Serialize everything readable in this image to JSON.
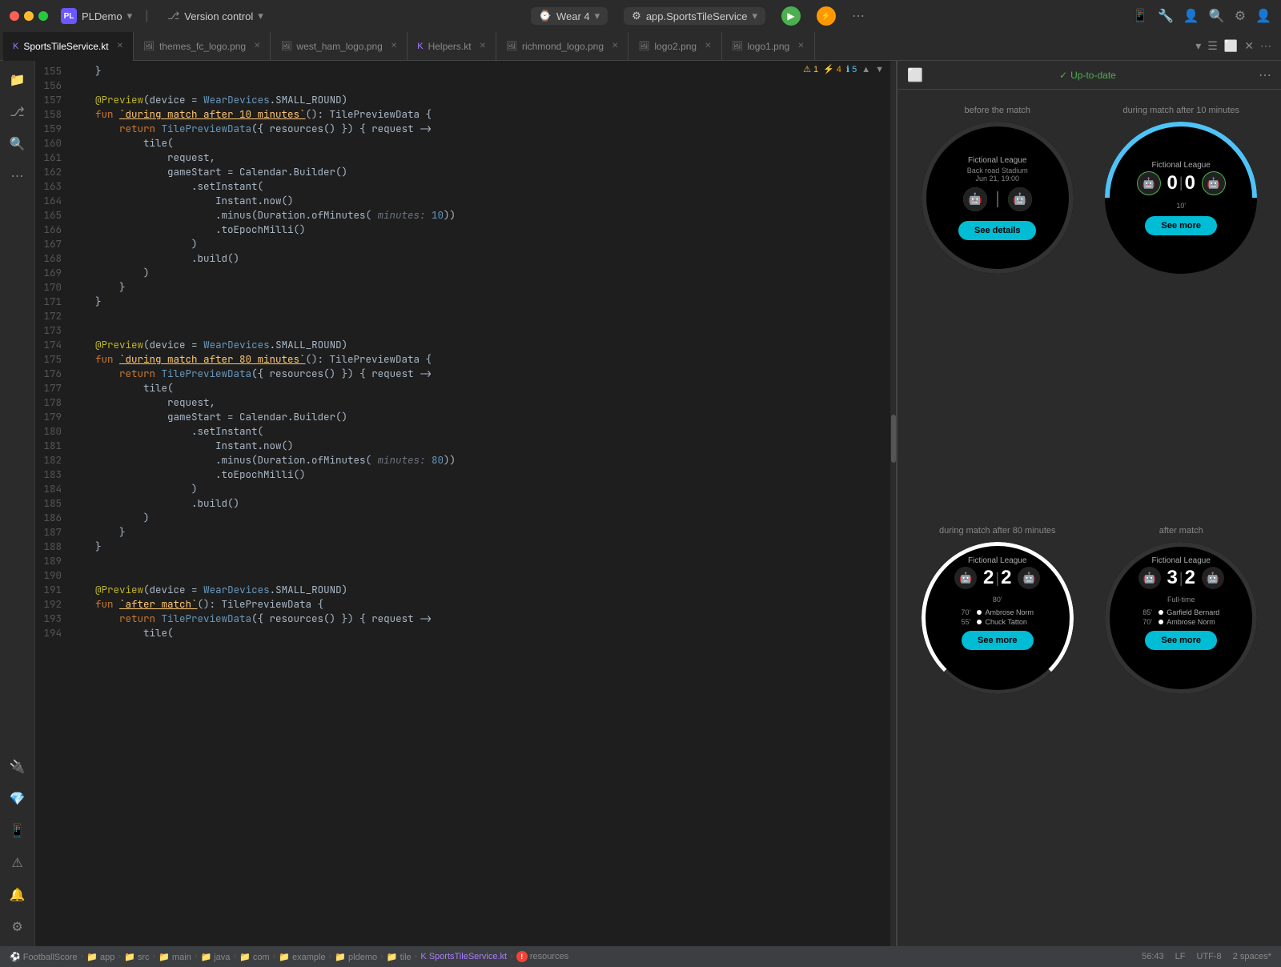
{
  "titlebar": {
    "project_icon_label": "PL",
    "project_name": "PLDemo",
    "version_control_label": "Version control",
    "device_label": "Wear 4",
    "service_label": "app.SportsTileService",
    "run_icon": "▶",
    "debug_icon": "⚡",
    "menu_icon": "⋯"
  },
  "tabs": [
    {
      "label": "SportsTileService.kt",
      "icon": "K",
      "active": true,
      "closeable": true
    },
    {
      "label": "themes_fc_logo.png",
      "icon": "🖼",
      "active": false,
      "closeable": true
    },
    {
      "label": "west_ham_logo.png",
      "icon": "🖼",
      "active": false,
      "closeable": true
    },
    {
      "label": "Helpers.kt",
      "icon": "K",
      "active": false,
      "closeable": true
    },
    {
      "label": "richmond_logo.png",
      "icon": "🖼",
      "active": false,
      "closeable": true
    },
    {
      "label": "logo2.png",
      "icon": "🖼",
      "active": false,
      "closeable": true
    },
    {
      "label": "logo1.png",
      "icon": "🖼",
      "active": false,
      "closeable": true
    }
  ],
  "editor": {
    "warnings": {
      "yellow": "1",
      "orange": "4",
      "blue": "5"
    },
    "lines": [
      {
        "num": "155",
        "tokens": [
          {
            "t": "    }",
            "c": "white"
          }
        ]
      },
      {
        "num": "156",
        "tokens": []
      },
      {
        "num": "157",
        "tokens": [
          {
            "t": "    @Preview",
            "c": "ann"
          },
          {
            "t": "(",
            "c": "white"
          },
          {
            "t": "device",
            "c": "white"
          },
          {
            "t": " = ",
            "c": "white"
          },
          {
            "t": "WearDevices",
            "c": "cls"
          },
          {
            "t": ".",
            "c": "white"
          },
          {
            "t": "SMALL_ROUND",
            "c": "white"
          },
          {
            "t": ")",
            "c": "white"
          }
        ]
      },
      {
        "num": "158",
        "tokens": [
          {
            "t": "    fun ",
            "c": "kw"
          },
          {
            "t": "`during match after 10 minutes`",
            "c": "fn",
            "underline": true
          },
          {
            "t": "(): TilePreviewData {",
            "c": "white"
          }
        ]
      },
      {
        "num": "159",
        "tokens": [
          {
            "t": "        return ",
            "c": "kw"
          },
          {
            "t": "TilePreviewData",
            "c": "cls"
          },
          {
            "t": "({ ",
            "c": "white"
          },
          {
            "t": "resources()",
            "c": "white"
          },
          {
            "t": " }) { request ->",
            "c": "white"
          }
        ]
      },
      {
        "num": "160",
        "tokens": [
          {
            "t": "            tile(",
            "c": "white"
          }
        ]
      },
      {
        "num": "161",
        "tokens": [
          {
            "t": "                request,",
            "c": "white"
          }
        ]
      },
      {
        "num": "162",
        "tokens": [
          {
            "t": "                gameStart = Calendar.Builder()",
            "c": "white"
          }
        ]
      },
      {
        "num": "163",
        "tokens": [
          {
            "t": "                    .setInstant(",
            "c": "white"
          }
        ]
      },
      {
        "num": "164",
        "tokens": [
          {
            "t": "                        Instant.now()",
            "c": "white"
          }
        ]
      },
      {
        "num": "165",
        "tokens": [
          {
            "t": "                        .minus(Duration.ofMinutes(",
            "c": "white"
          },
          {
            "t": " minutes: ",
            "c": "hint"
          },
          {
            "t": "10",
            "c": "num"
          },
          {
            "t": "))",
            "c": "white"
          }
        ]
      },
      {
        "num": "166",
        "tokens": [
          {
            "t": "                        .toEpochMilli()",
            "c": "white"
          }
        ]
      },
      {
        "num": "167",
        "tokens": [
          {
            "t": "                    )",
            "c": "white"
          }
        ]
      },
      {
        "num": "168",
        "tokens": [
          {
            "t": "                    .build()",
            "c": "white"
          }
        ]
      },
      {
        "num": "169",
        "tokens": [
          {
            "t": "            )",
            "c": "white"
          }
        ]
      },
      {
        "num": "170",
        "tokens": [
          {
            "t": "        }",
            "c": "white"
          }
        ]
      },
      {
        "num": "171",
        "tokens": [
          {
            "t": "    }",
            "c": "white"
          }
        ]
      },
      {
        "num": "172",
        "tokens": []
      },
      {
        "num": "173",
        "tokens": []
      },
      {
        "num": "174",
        "tokens": [
          {
            "t": "    @Preview",
            "c": "ann"
          },
          {
            "t": "(",
            "c": "white"
          },
          {
            "t": "device",
            "c": "white"
          },
          {
            "t": " = ",
            "c": "white"
          },
          {
            "t": "WearDevices",
            "c": "cls"
          },
          {
            "t": ".",
            "c": "white"
          },
          {
            "t": "SMALL_ROUND",
            "c": "white"
          },
          {
            "t": ")",
            "c": "white"
          }
        ]
      },
      {
        "num": "175",
        "tokens": [
          {
            "t": "    fun ",
            "c": "kw"
          },
          {
            "t": "`during match after 80 minutes`",
            "c": "fn",
            "underline": true
          },
          {
            "t": "(): TilePreviewData {",
            "c": "white"
          }
        ]
      },
      {
        "num": "176",
        "tokens": [
          {
            "t": "        return ",
            "c": "kw"
          },
          {
            "t": "TilePreviewData",
            "c": "cls"
          },
          {
            "t": "({ ",
            "c": "white"
          },
          {
            "t": "resources()",
            "c": "white"
          },
          {
            "t": " }) { request ->",
            "c": "white"
          }
        ]
      },
      {
        "num": "177",
        "tokens": [
          {
            "t": "            tile(",
            "c": "white"
          }
        ]
      },
      {
        "num": "178",
        "tokens": [
          {
            "t": "                request,",
            "c": "white"
          }
        ]
      },
      {
        "num": "179",
        "tokens": [
          {
            "t": "                gameStart = Calendar.Builder()",
            "c": "white"
          }
        ]
      },
      {
        "num": "180",
        "tokens": [
          {
            "t": "                    .setInstant(",
            "c": "white"
          }
        ]
      },
      {
        "num": "181",
        "tokens": [
          {
            "t": "                        Instant.now()",
            "c": "white"
          }
        ]
      },
      {
        "num": "182",
        "tokens": [
          {
            "t": "                        .minus(Duration.ofMinutes(",
            "c": "white"
          },
          {
            "t": " minutes: ",
            "c": "hint"
          },
          {
            "t": "80",
            "c": "num"
          },
          {
            "t": "))",
            "c": "white"
          }
        ]
      },
      {
        "num": "183",
        "tokens": [
          {
            "t": "                        .toEpochMilli()",
            "c": "white"
          }
        ]
      },
      {
        "num": "184",
        "tokens": [
          {
            "t": "                    )",
            "c": "white"
          }
        ]
      },
      {
        "num": "185",
        "tokens": [
          {
            "t": "                    .build()",
            "c": "white"
          }
        ]
      },
      {
        "num": "186",
        "tokens": [
          {
            "t": "            )",
            "c": "white"
          }
        ]
      },
      {
        "num": "187",
        "tokens": [
          {
            "t": "        }",
            "c": "white"
          }
        ]
      },
      {
        "num": "188",
        "tokens": [
          {
            "t": "    }",
            "c": "white"
          }
        ]
      },
      {
        "num": "189",
        "tokens": []
      },
      {
        "num": "190",
        "tokens": []
      },
      {
        "num": "191",
        "tokens": [
          {
            "t": "    @Preview",
            "c": "ann"
          },
          {
            "t": "(",
            "c": "white"
          },
          {
            "t": "device",
            "c": "white"
          },
          {
            "t": " = ",
            "c": "white"
          },
          {
            "t": "WearDevices",
            "c": "cls"
          },
          {
            "t": ".",
            "c": "white"
          },
          {
            "t": "SMALL_ROUND",
            "c": "white"
          },
          {
            "t": ")",
            "c": "white"
          }
        ]
      },
      {
        "num": "192",
        "tokens": [
          {
            "t": "    fun ",
            "c": "kw"
          },
          {
            "t": "`after match`",
            "c": "fn",
            "underline": true
          },
          {
            "t": "(): TilePreviewData {",
            "c": "white"
          }
        ]
      },
      {
        "num": "193",
        "tokens": [
          {
            "t": "        return ",
            "c": "kw"
          },
          {
            "t": "TilePreviewData",
            "c": "cls"
          },
          {
            "t": "({ ",
            "c": "white"
          },
          {
            "t": "resources()",
            "c": "white"
          },
          {
            "t": " }) { request ->",
            "c": "white"
          }
        ]
      },
      {
        "num": "194",
        "tokens": [
          {
            "t": "            tile(",
            "c": "white"
          }
        ]
      }
    ]
  },
  "preview": {
    "status": "Up-to-date",
    "cells": [
      {
        "label": "before the match",
        "type": "before",
        "league": "Fictional League",
        "venue": "Back road Stadium",
        "date": "Jun 21, 19:00",
        "score_left": "",
        "score_right": "",
        "minute": "",
        "button_label": "See details",
        "scorers": [],
        "arc": "none"
      },
      {
        "label": "during match after 10 minutes",
        "type": "during10",
        "league": "Fictional League",
        "venue": "",
        "date": "",
        "score_left": "0",
        "score_right": "0",
        "minute": "10'",
        "button_label": "See more",
        "scorers": [],
        "arc": "blue"
      },
      {
        "label": "during match after 80 minutes",
        "type": "during80",
        "league": "Fictional League",
        "venue": "",
        "date": "",
        "score_left": "2",
        "score_right": "2",
        "minute": "80'",
        "button_label": "See more",
        "scorers": [
          {
            "min": "70'",
            "name": "Ambrose Norm"
          },
          {
            "min": "55'",
            "name": "Chuck Tatton"
          }
        ],
        "arc": "white"
      },
      {
        "label": "after match",
        "type": "after",
        "league": "Fictional League",
        "venue": "",
        "date": "",
        "score_left": "3",
        "score_right": "2",
        "minute": "Full-time",
        "button_label": "See more",
        "scorers": [
          {
            "min": "85'",
            "name": "Garfield Bernard"
          },
          {
            "min": "70'",
            "name": "Ambrose Norm"
          }
        ],
        "arc": "none"
      }
    ]
  },
  "statusbar": {
    "project": "FootballScore",
    "breadcrumbs": [
      "app",
      "src",
      "main",
      "java",
      "com",
      "example",
      "pldemo",
      "tile",
      "SportsTileService.kt",
      "resources"
    ],
    "position": "56:43",
    "line_sep": "LF",
    "encoding": "UTF-8",
    "indent": "2 spaces*"
  }
}
